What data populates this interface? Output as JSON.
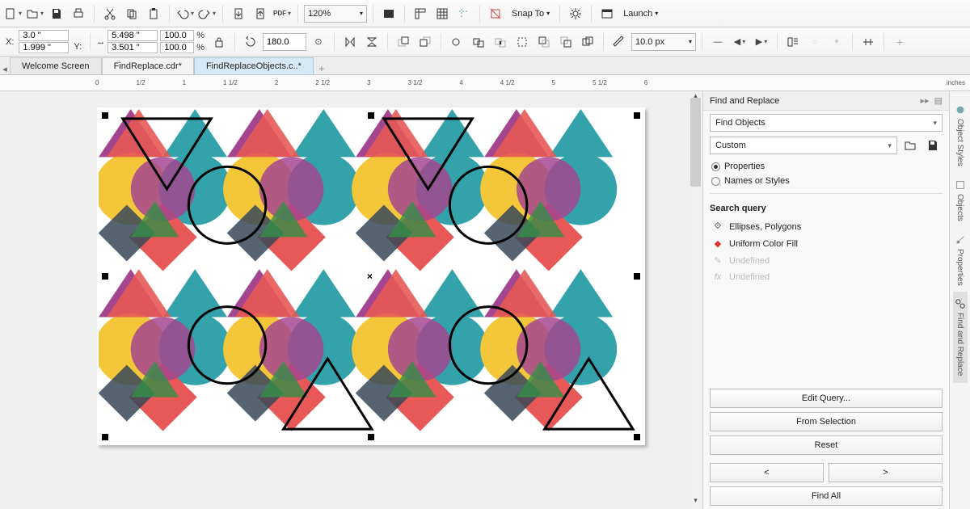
{
  "toolbar1": {
    "zoom": "120%",
    "snap_to": "Snap To",
    "launch": "Launch"
  },
  "toolbar2": {
    "x_label": "X:",
    "y_label": "Y:",
    "x_val": "3.0 \"",
    "y_val": "1.999 \"",
    "w_val": "5.498 \"",
    "h_val": "3.501 \"",
    "sx": "100.0",
    "sy": "100.0",
    "pct": "%",
    "rot": "180.0",
    "outline": "10.0 px"
  },
  "tabs": {
    "welcome": "Welcome Screen",
    "doc1": "FindReplace.cdr*",
    "doc2": "FindReplaceObjects.c..*"
  },
  "ruler": {
    "units": "inches",
    "ticks": [
      "0",
      "1/2",
      "1",
      "1 1/2",
      "2",
      "2 1/2",
      "3",
      "3 1/2",
      "4",
      "4 1/2",
      "5",
      "5 1/2",
      "6"
    ]
  },
  "panel": {
    "title": "Find and Replace",
    "mode": "Find Objects",
    "preset": "Custom",
    "radio_properties": "Properties",
    "radio_names": "Names or Styles",
    "query_hd": "Search query",
    "row_shapes": "Ellipses, Polygons",
    "row_fill": "Uniform Color Fill",
    "row_outline": "Undefined",
    "row_fx": "Undefined",
    "btn_edit": "Edit Query...",
    "btn_fromsel": "From Selection",
    "btn_reset": "Reset",
    "btn_prev": "<",
    "btn_next": ">",
    "btn_findall": "Find All"
  },
  "side_tabs": {
    "styles": "Object Styles",
    "objects": "Objects",
    "properties": "Properties",
    "find": "Find and Replace"
  }
}
